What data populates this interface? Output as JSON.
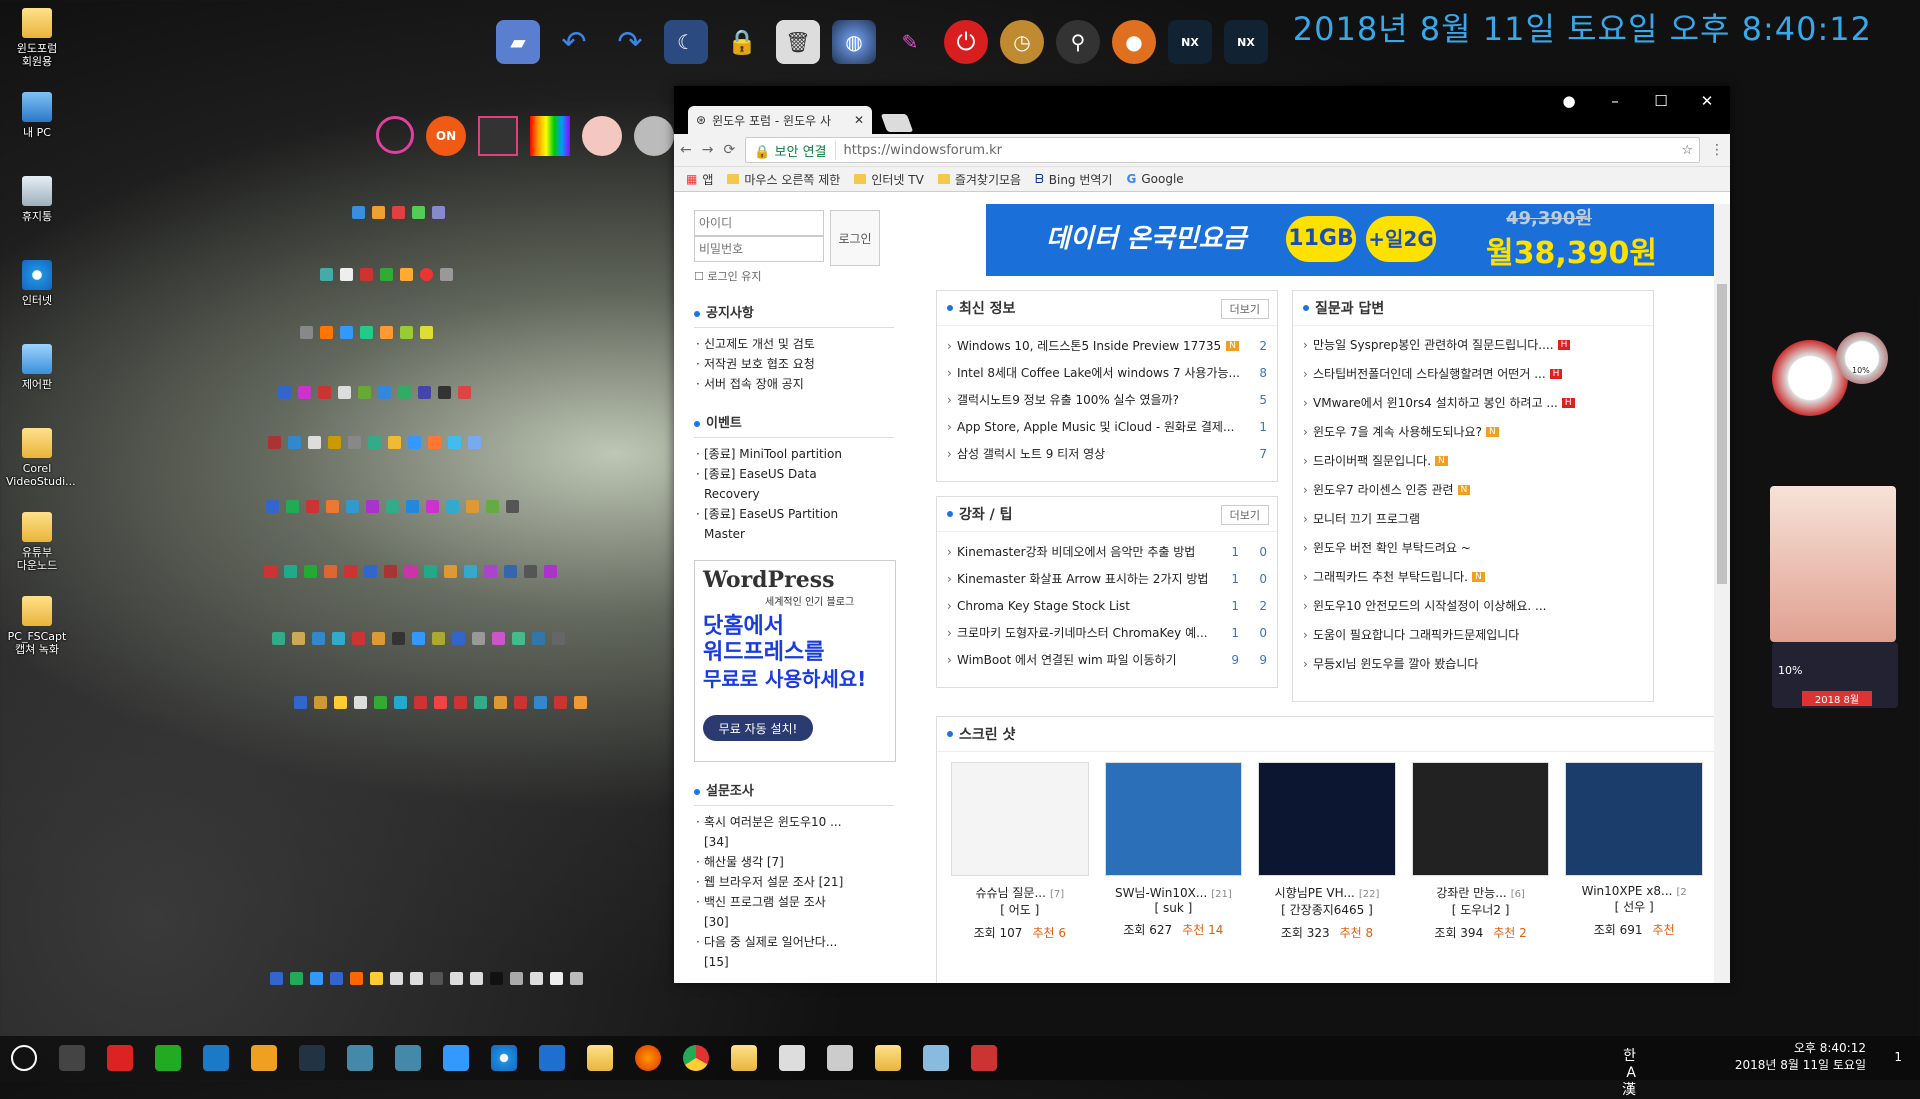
{
  "desktop_icons": [
    {
      "label": "윈도포럼\n회원용",
      "type": "folder"
    },
    {
      "label": "내 PC",
      "type": "pc"
    },
    {
      "label": "휴지통",
      "type": "bin"
    },
    {
      "label": "인터넷",
      "type": "ie"
    },
    {
      "label": "제어판",
      "type": "cp"
    },
    {
      "label": "Corel\nVideoStudi...",
      "type": "folder"
    },
    {
      "label": "유튜부\n다운노드",
      "type": "folder"
    },
    {
      "label": "PC_FSCapt\n캡쳐 녹화",
      "type": "folder"
    }
  ],
  "top_clock": "2018년 8월 11일 토요일 오후 8:40:12",
  "browser": {
    "tab_title": "윈도우 포럼 - 윈도우 사",
    "security_label": "보안 연결",
    "url": "https://windowsforum.kr",
    "bookmarks": [
      "앱",
      "마우스 오른쪽 제한",
      "인터넷 TV",
      "즐겨찾기모음",
      "Bing 번역기",
      "Google"
    ],
    "login": {
      "id_placeholder": "아이디",
      "pw_placeholder": "비밀번호",
      "button": "로그인",
      "keep": "로그인 유지"
    },
    "notice": {
      "title": "공지사항",
      "items": [
        "신고제도 개선 및 검토",
        "저작권 보호 협조 요청",
        "서버 접속 장애 공지"
      ]
    },
    "event": {
      "title": "이벤트",
      "items": [
        "[종료] MiniTool partition",
        "[종료] EaseUS Data Recovery",
        "[종료] EaseUS Partition Master"
      ]
    },
    "wp_ad": {
      "logo": "WordPress",
      "sub": "세계적인 인기 블로그",
      "big1": "닷홈에서",
      "big2": "워드프레스를",
      "big3": "무료로 사용하세요!",
      "button": "무료 자동 설치!"
    },
    "survey": {
      "title": "설문조사",
      "items": [
        "혹시 여러분은 윈도우10 ... [34]",
        "해산물 생각 [7]",
        "웹 브라우저 설문 조사 [21]",
        "백신 프로그램 설문 조사 [30]",
        "다음 중 실제로 일어난다... [15]"
      ]
    },
    "banner": {
      "text1": "데이터 온국민요금",
      "text2": "11GB",
      "text3": "+일2G",
      "old_price": "49,390원",
      "price": "월38,390원"
    },
    "latest": {
      "title": "최신 정보",
      "more": "더보기",
      "items": [
        {
          "t": "Windows 10, 레드스톤5 Inside Preview 17735 / 1...",
          "c": "2",
          "badge": "N"
        },
        {
          "t": "Intel 8세대 Coffee Lake에서 windows 7 사용가능...",
          "c": "8",
          "badge": ""
        },
        {
          "t": "갤럭시노트9 정보 유출 100% 실수 였을까?",
          "c": "5",
          "badge": ""
        },
        {
          "t": "App Store, Apple Music 및 iCloud - 원화로 결제...",
          "c": "1",
          "badge": ""
        },
        {
          "t": "삼성 갤럭시 노트 9 티저 영상",
          "c": "7",
          "badge": ""
        }
      ]
    },
    "qa": {
      "title": "질문과 답변",
      "items": [
        {
          "t": "만능일 Sysprep봉인 관련하여 질문드립니다....",
          "badge": "H"
        },
        {
          "t": "스타팁버전폴더인데 스타실행할려면 어떤거 ...",
          "badge": "H"
        },
        {
          "t": "VMware에서 윈10rs4 설치하고 봉인 하려고 ...",
          "badge": "H"
        },
        {
          "t": "윈도우 7을 계속 사용해도되나요?",
          "badge": "N"
        },
        {
          "t": "드라이버팩 질문입니다.",
          "badge": "N"
        },
        {
          "t": "윈도우7 라이센스 인증 관련",
          "badge": "N"
        },
        {
          "t": "모니터 끄기 프로그램",
          "badge": ""
        },
        {
          "t": "윈도우 버전 확인 부탁드려요 ~",
          "badge": ""
        },
        {
          "t": "그래픽카드 추천 부탁드립니다.",
          "badge": "N"
        },
        {
          "t": "윈도우10 안전모드의 시작설정이 이상해요. ...",
          "badge": ""
        },
        {
          "t": "도움이 필요합니다 그래픽카드문제입니다",
          "badge": ""
        },
        {
          "t": "무등xl님 윈도우를 깔아 봤습니다",
          "badge": ""
        }
      ]
    },
    "tips": {
      "title": "강좌 / 팁",
      "more": "더보기",
      "items": [
        {
          "t": "Kinemaster강좌 비데오에서 음악만 추출 방법",
          "l": "1",
          "c": "0"
        },
        {
          "t": "Kinemaster 화살표 Arrow 표시하는 2가지 방법",
          "l": "1",
          "c": "0"
        },
        {
          "t": "Chroma Key Stage Stock List",
          "l": "1",
          "c": "2"
        },
        {
          "t": "크로마키 도형자료-키네마스터 ChromaKey 예...",
          "l": "1",
          "c": "0"
        },
        {
          "t": "WimBoot 에서 연결된 wim 파일 이동하기",
          "l": "9",
          "c": "9"
        }
      ]
    },
    "screenshots": {
      "title": "스크린 샷",
      "items": [
        {
          "t": "슈슈님 질문...",
          "n": "[7]",
          "a": "[ 어도 ]",
          "v": "조회 107",
          "r": "추천 6"
        },
        {
          "t": "SW님-Win10X...",
          "n": "[21]",
          "a": "[ suk ]",
          "v": "조회 627",
          "r": "추천 14"
        },
        {
          "t": "시향님PE VH...",
          "n": "[22]",
          "a": "[ 간장종지6465 ]",
          "v": "조회 323",
          "r": "추천 8"
        },
        {
          "t": "강좌란 만능...",
          "n": "[6]",
          "a": "[ 도우너2 ]",
          "v": "조회 394",
          "r": "추천 2"
        },
        {
          "t": "Win10XPE x8...",
          "n": "[2",
          "a": "[ 선우 ]",
          "v": "조회 691",
          "r": "추천"
        }
      ]
    }
  },
  "tray": {
    "ime": "한 A 漢",
    "time": "오후 8:40:12",
    "date": "2018년 8월 11일 토요일",
    "notif": "1"
  },
  "gadgets": {
    "cpu": "18%",
    "mem": "10%",
    "vol": "10%",
    "cal_label": "2018 8월"
  }
}
